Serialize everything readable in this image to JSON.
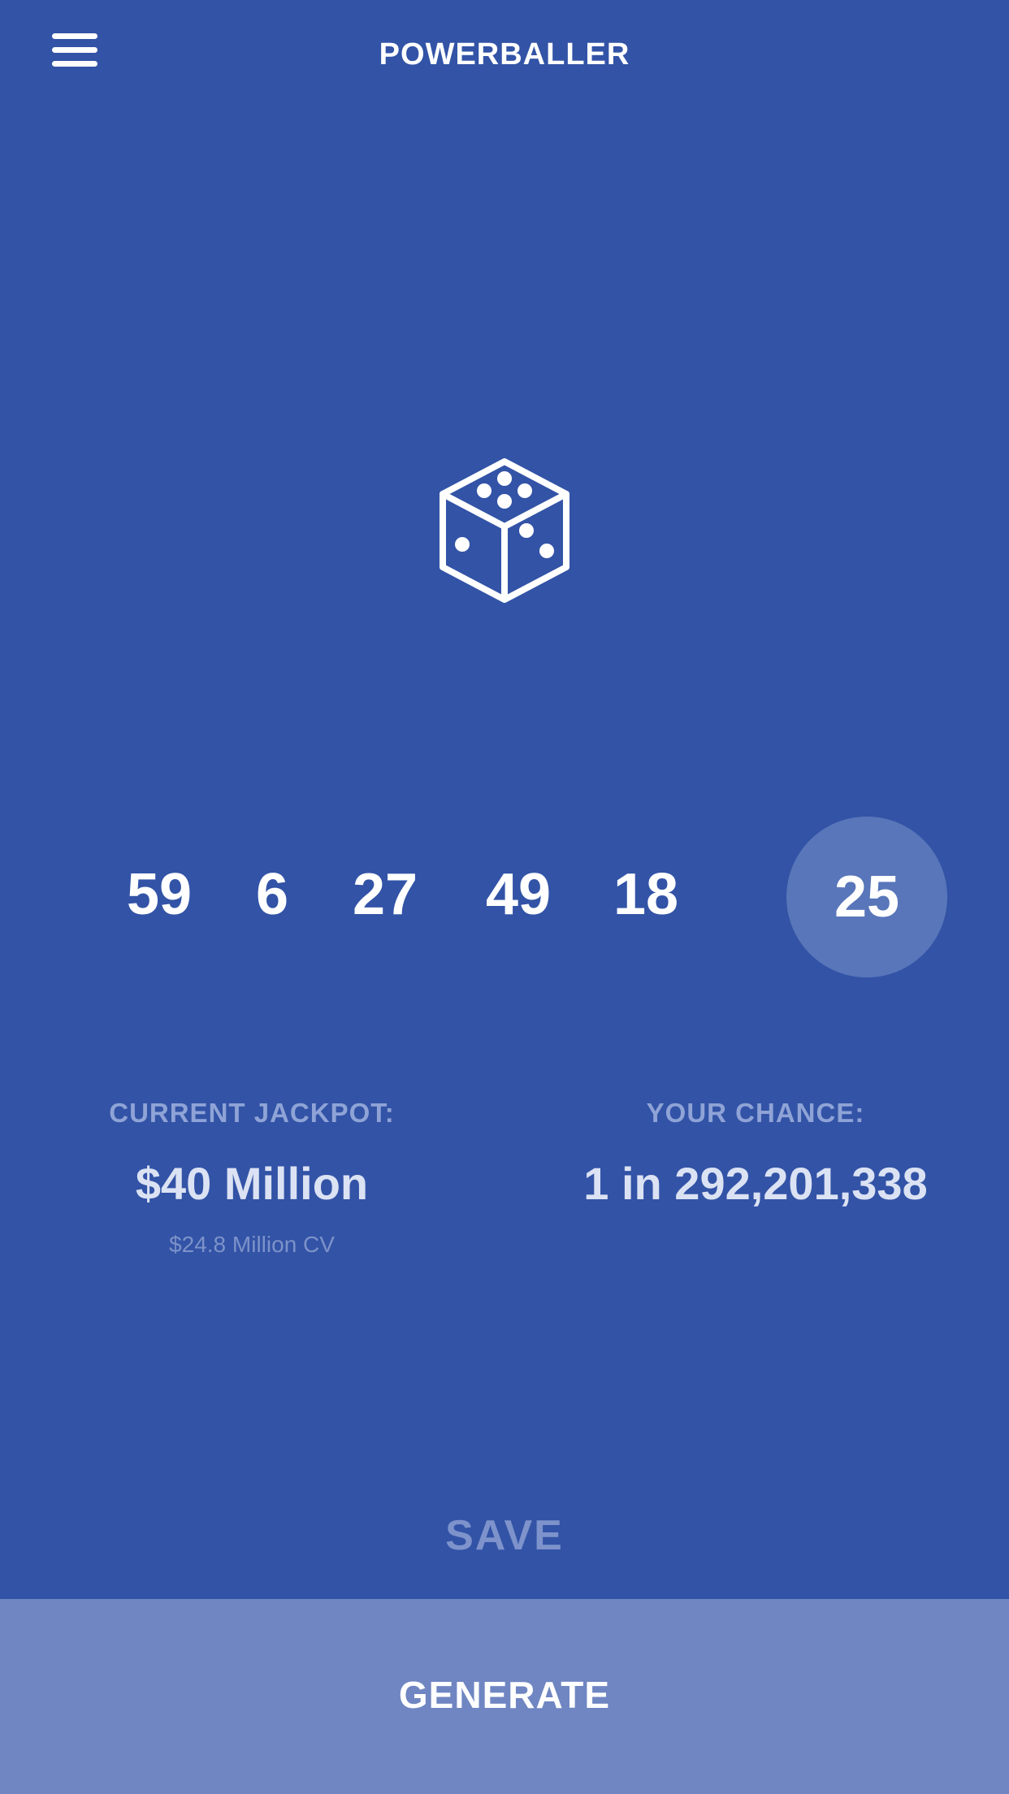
{
  "header": {
    "title": "POWERBALLER",
    "menu_icon": "hamburger-menu-icon"
  },
  "dice": {
    "icon": "dice-icon"
  },
  "numbers": {
    "white_balls": [
      "59",
      "6",
      "27",
      "49",
      "18"
    ],
    "power_ball": "25"
  },
  "stats": {
    "jackpot_label": "CURRENT JACKPOT:",
    "jackpot_value": "$40 Million",
    "jackpot_cash_value": "$24.8 Million CV",
    "chance_label": "YOUR CHANCE:",
    "chance_value": "1 in 292,201,338"
  },
  "actions": {
    "save_label": "SAVE",
    "generate_label": "GENERATE"
  },
  "colors": {
    "background": "#3253a6",
    "power_ball": "#5876b9",
    "generate_bar": "#6f86c2",
    "muted_text": "#8fa3d6"
  }
}
